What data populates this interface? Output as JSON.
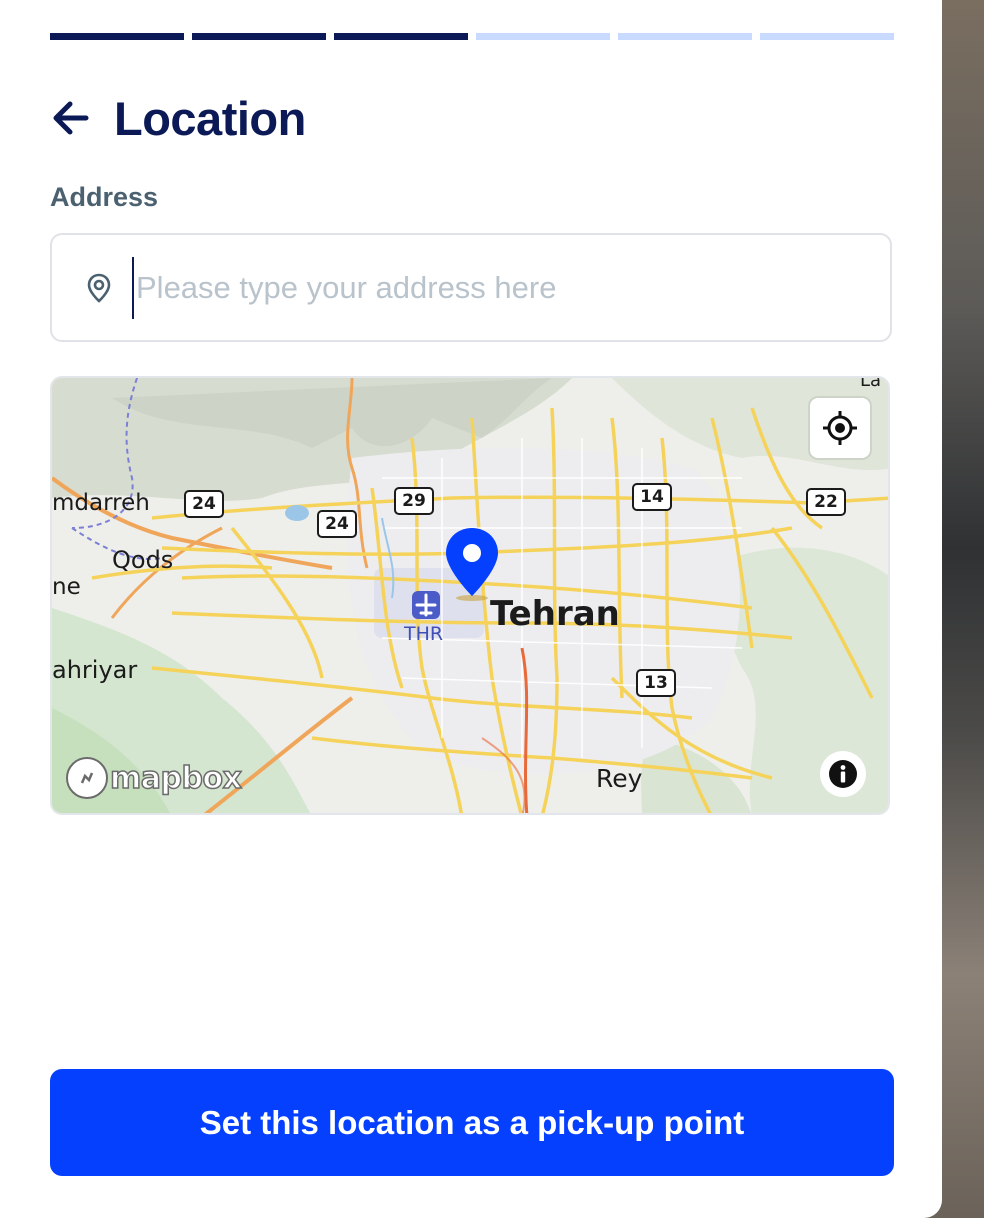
{
  "progress": {
    "total_steps": 6,
    "completed_steps": 3
  },
  "header": {
    "title": "Location",
    "back_icon": "arrow-left-icon"
  },
  "address": {
    "label": "Address",
    "placeholder": "Please type your address here",
    "value": "",
    "icon": "location-pin-icon"
  },
  "map": {
    "attribution": "mapbox",
    "places": {
      "tehran": "Tehran",
      "qods": "Qods",
      "shahriyar_partial": "ahriyar",
      "eslamshahr_partial": "ne",
      "mamdarreh_partial": "mdarreh",
      "rey": "Rey",
      "airport_code": "THR",
      "top_right_partial": "La"
    },
    "road_shields": [
      "24",
      "24",
      "29",
      "14",
      "22",
      "13"
    ],
    "locate_icon": "crosshair-icon",
    "info_icon": "info-icon",
    "marker_icon": "map-marker-icon"
  },
  "cta": {
    "label": "Set this location as a pick-up point"
  },
  "colors": {
    "primary_dark": "#0b1a57",
    "primary": "#0540ff",
    "progress_inactive": "#c8daff",
    "label_gray": "#4b6170"
  }
}
